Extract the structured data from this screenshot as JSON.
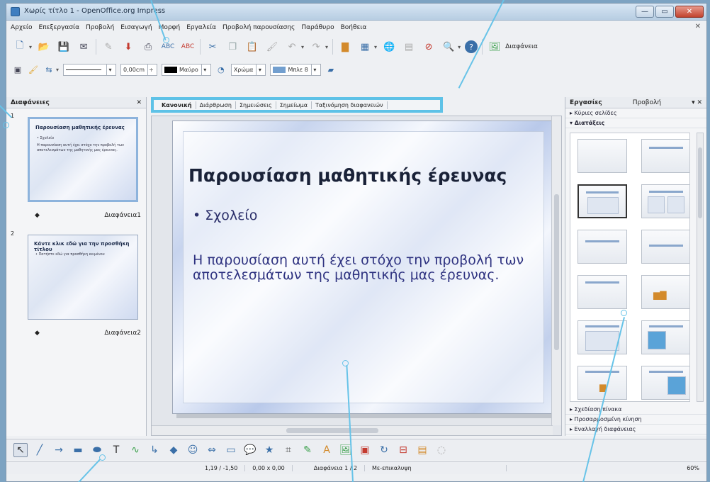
{
  "window": {
    "title": "Χωρίς τίτλο 1 - OpenOffice.org Impress",
    "min_label": "—",
    "max_label": "▭",
    "close_label": "✕"
  },
  "menu": {
    "items": [
      "Αρχείο",
      "Επεξεργασία",
      "Προβολή",
      "Εισαγωγή",
      "Μορφή",
      "Εργαλεία",
      "Προβολή παρουσίασης",
      "Παράθυρο",
      "Βοήθεια"
    ],
    "doc_close": "✕"
  },
  "toolbar": {
    "slide_button_label": "Διαφάνεια",
    "line_width": "0,00cm",
    "line_color": "Μαύρο",
    "area_style": "Χρώμα",
    "area_color": "Μπλε 8"
  },
  "slides_pane": {
    "title": "Διαφάνειες",
    "close": "✕",
    "slides": [
      {
        "number": "1",
        "title": "Παρουσίαση μαθητικής έρευνας",
        "bullet": "• Σχολείο",
        "body": "Η παρουσίαση αυτή έχει στόχο την προβολή των αποτελεσμάτων της μαθητικής μας έρευνας.",
        "label": "Διαφάνεια1"
      },
      {
        "number": "2",
        "title": "Κάντε κλικ εδώ για την προσθήκη τίτλου",
        "bullet": "• Πατήστε εδώ για προσθήκη κειμένου",
        "body": "",
        "label": "Διαφάνεια2"
      }
    ]
  },
  "view_tabs": [
    "Κανονική",
    "Διάρθρωση",
    "Σημειώσεις",
    "Σημείωμα",
    "Ταξινόμηση διαφανειών"
  ],
  "slide": {
    "title": "Παρουσίαση μαθητικής έρευνας",
    "bullet": "• Σχολείο",
    "body": "Η παρουσίαση αυτή έχει στόχο την προβολή των αποτελεσμάτων της μαθητικής μας έρευνας."
  },
  "tasks_pane": {
    "title": "Εργασίες",
    "view": "Προβολή",
    "close": "▾ ✕",
    "sections_top": [
      "▸ Κύριες σελίδες",
      "▾ Διατάξεις"
    ],
    "sections_bottom": [
      "▸ Σχεδίαση πίνακα",
      "▸ Προσαρμοσμένη κίνηση",
      "▸ Εναλλαγή διαφάνειας"
    ]
  },
  "status": {
    "position": "1,19 / -1,50",
    "size": "0,00 x 0,00",
    "slide": "Διαφάνεια 1 / 2",
    "master": "Με-επικαλυψη",
    "zoom": "60%"
  }
}
